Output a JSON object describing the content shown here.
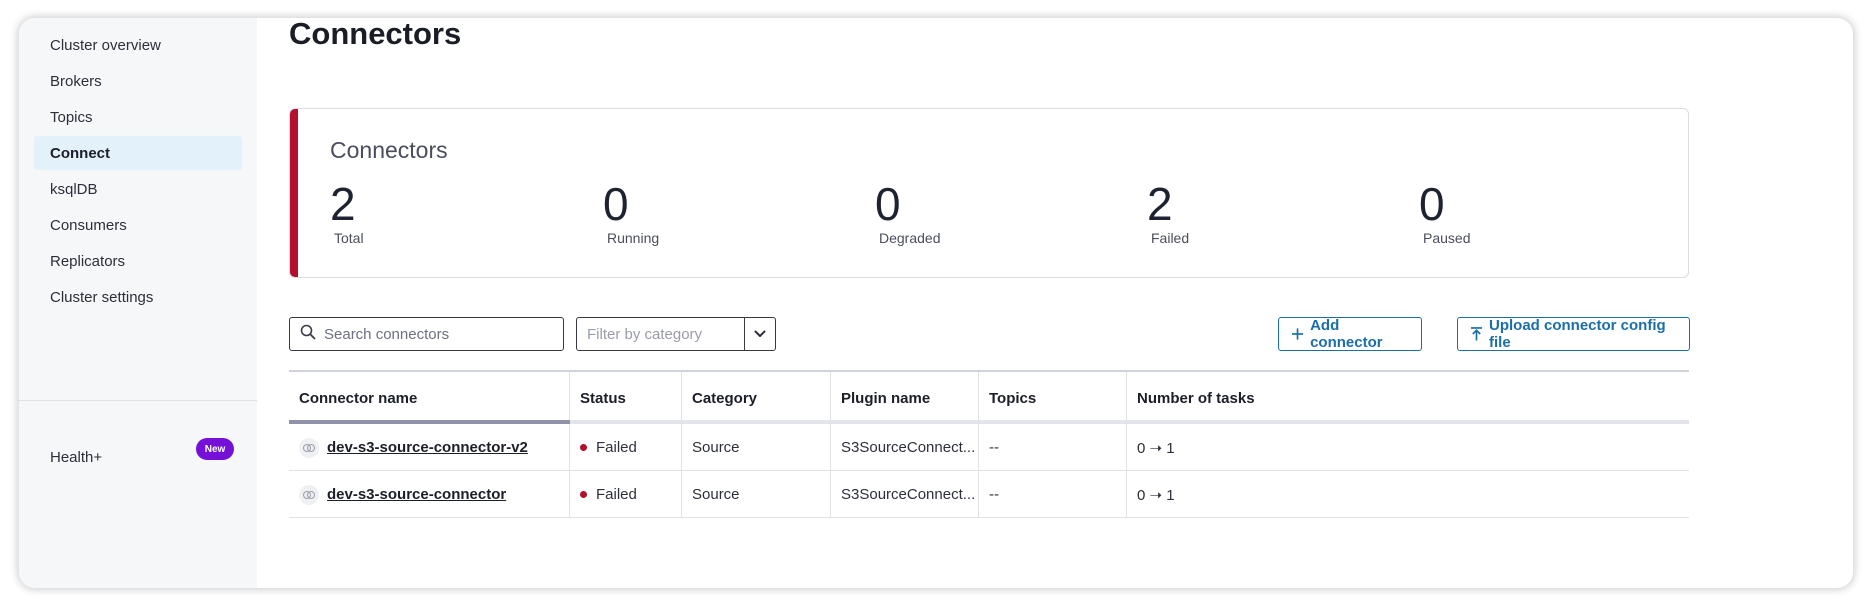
{
  "sidebar": {
    "items": [
      {
        "label": "Cluster overview"
      },
      {
        "label": "Brokers"
      },
      {
        "label": "Topics"
      },
      {
        "label": "Connect",
        "active": true
      },
      {
        "label": "ksqlDB"
      },
      {
        "label": "Consumers"
      },
      {
        "label": "Replicators"
      },
      {
        "label": "Cluster settings"
      }
    ],
    "health_label": "Health+",
    "health_badge": "New"
  },
  "page": {
    "title": "Connectors"
  },
  "stats": {
    "title": "Connectors",
    "accent_color": "#b2102e",
    "items": [
      {
        "value": "2",
        "label": "Total"
      },
      {
        "value": "0",
        "label": "Running"
      },
      {
        "value": "0",
        "label": "Degraded"
      },
      {
        "value": "2",
        "label": "Failed"
      },
      {
        "value": "0",
        "label": "Paused"
      }
    ]
  },
  "toolbar": {
    "search_placeholder": "Search connectors",
    "filter_placeholder": "Filter by category",
    "add_label": "Add connector",
    "upload_label": "Upload connector config file"
  },
  "table": {
    "columns": [
      "Connector name",
      "Status",
      "Category",
      "Plugin name",
      "Topics",
      "Number of tasks"
    ],
    "rows": [
      {
        "name": "dev-s3-source-connector-v2",
        "status": "Failed",
        "category": "Source",
        "plugin": "S3SourceConnect...",
        "topics": "--",
        "tasks": "0 ➝ 1"
      },
      {
        "name": "dev-s3-source-connector",
        "status": "Failed",
        "category": "Source",
        "plugin": "S3SourceConnect...",
        "topics": "--",
        "tasks": "0 ➝ 1"
      }
    ]
  },
  "colors": {
    "brand_blue": "#1a6fa8",
    "failed_red": "#b2102e",
    "badge_purple": "#7511d6",
    "active_nav": "#e3f1fb"
  }
}
